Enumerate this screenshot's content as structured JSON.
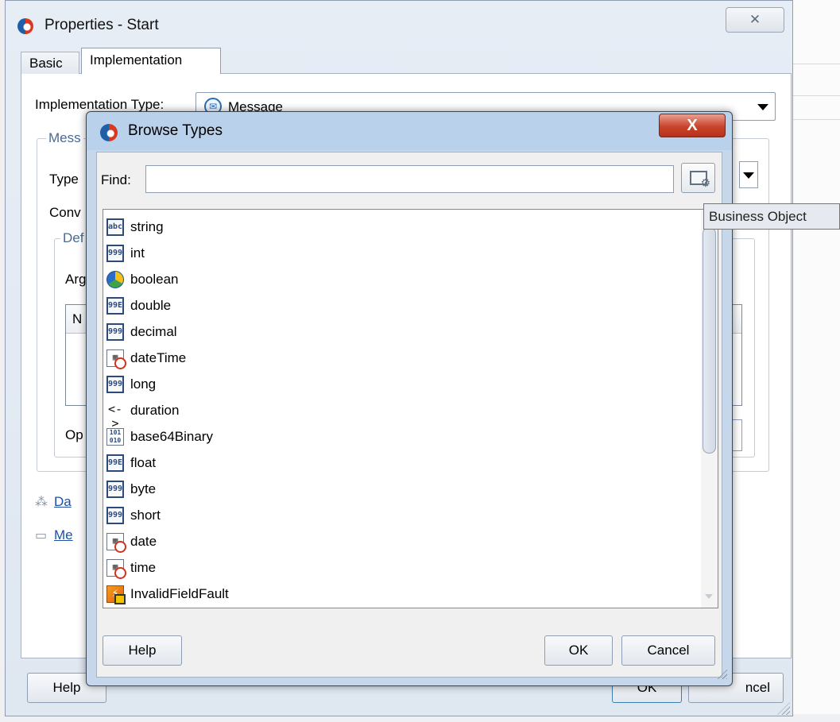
{
  "outer_dialog": {
    "title": "Properties - Start",
    "tabs": [
      {
        "label": "Basic"
      },
      {
        "label": "Implementation"
      }
    ],
    "implementation_type_label": "Implementation Type:",
    "implementation_type_value": "Message",
    "group_legend": "Mess",
    "type_label": "Type",
    "conversation_label": "Conv",
    "inner_group_legend": "Def",
    "arguments_label": "Arg",
    "table_header": "N",
    "options_label": "Op",
    "side_links": [
      {
        "label": "Da",
        "icon": "data-association-icon"
      },
      {
        "label": "Me",
        "icon": "message-icon"
      }
    ],
    "buttons": {
      "help": "Help",
      "ok": "OK",
      "cancel": "ncel"
    }
  },
  "browse_dialog": {
    "title": "Browse Types",
    "close_glyph": "X",
    "find_label": "Find:",
    "find_value": "",
    "types": [
      {
        "label": "string",
        "icon": "abc"
      },
      {
        "label": "int",
        "icon": "999"
      },
      {
        "label": "boolean",
        "icon": "bool"
      },
      {
        "label": "double",
        "icon": "99E"
      },
      {
        "label": "decimal",
        "icon": "999"
      },
      {
        "label": "dateTime",
        "icon": "cal"
      },
      {
        "label": "long",
        "icon": "999"
      },
      {
        "label": "duration",
        "icon": "<->"
      },
      {
        "label": "base64Binary",
        "icon": "bin"
      },
      {
        "label": "float",
        "icon": "99E"
      },
      {
        "label": "byte",
        "icon": "999"
      },
      {
        "label": "short",
        "icon": "999"
      },
      {
        "label": "date",
        "icon": "cal"
      },
      {
        "label": "time",
        "icon": "cal"
      },
      {
        "label": "InvalidFieldFault",
        "icon": "fault"
      }
    ],
    "buttons": {
      "help": "Help",
      "ok": "OK",
      "cancel": "Cancel"
    }
  },
  "tooltip": "Business Object"
}
